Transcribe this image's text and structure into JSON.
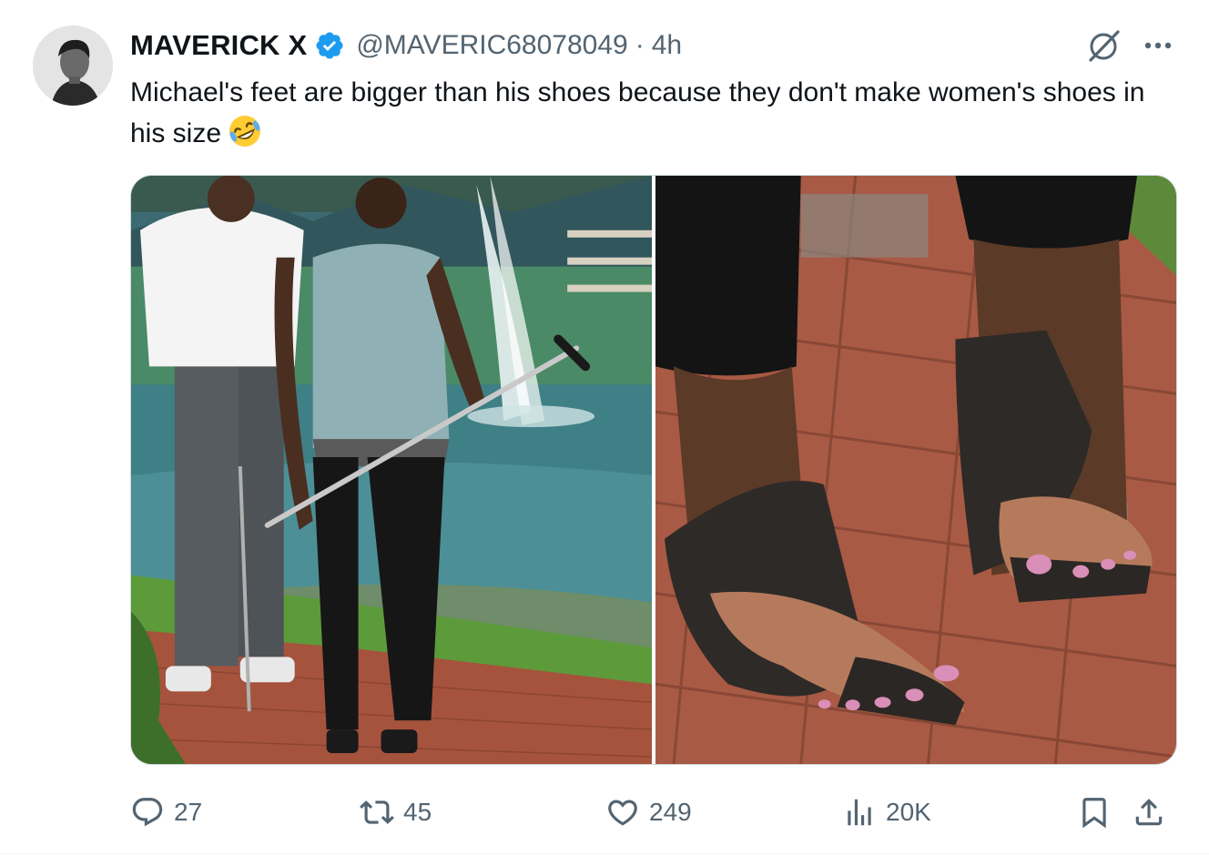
{
  "tweet": {
    "display_name": "MAVERICK X",
    "handle": "@MAVERIC68078049",
    "separator": "·",
    "time": "4h",
    "text": "Michael's feet are bigger than his shoes because they don't make women's shoes in his size",
    "emoji": "rolling-on-the-floor-laughing-icon"
  },
  "actions": {
    "replies": "27",
    "reposts": "45",
    "likes": "249",
    "views": "20K"
  },
  "colors": {
    "text": "#0f1419",
    "secondary": "#536471",
    "verified": "#1d9bf0",
    "border": "#cfd9de"
  },
  "icons": [
    "verified-badge-icon",
    "grok-icon",
    "more-icon",
    "reply-icon",
    "repost-icon",
    "like-icon",
    "views-icon",
    "bookmark-icon",
    "share-icon"
  ]
}
